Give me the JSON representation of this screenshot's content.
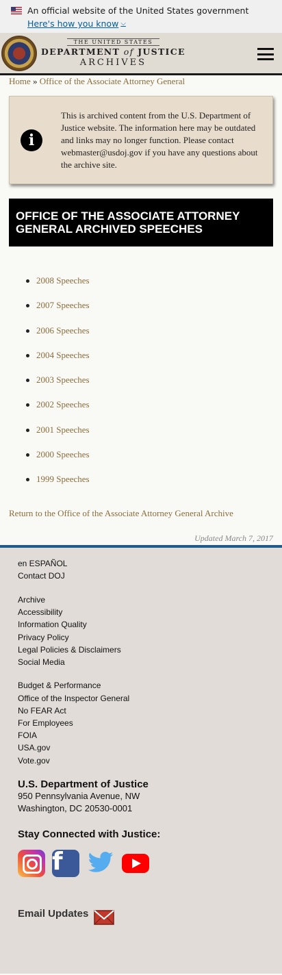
{
  "gov_banner": {
    "text": "An official website of the United States government",
    "link": "Here's how you know"
  },
  "header": {
    "logo_top": "THE UNITED STATES",
    "logo_mid_left": "DEPARTMENT",
    "logo_mid_of": "of",
    "logo_mid_right": "JUSTICE",
    "logo_bottom": "ARCHIVES"
  },
  "breadcrumb": {
    "home": "Home",
    "separator": "»",
    "current": "Office of the Associate Attorney General"
  },
  "notice": {
    "icon": "info-icon",
    "text": "This is archived content from the U.S. Department of Justice website. The information here may be outdated and links may no longer function. Please contact webmaster@usdoj.gov if you have any questions about the archive site."
  },
  "page_title": "OFFICE OF THE ASSOCIATE ATTORNEY GENERAL ARCHIVED SPEECHES",
  "speeches": [
    {
      "label": "2008 Speeches"
    },
    {
      "label": "2007 Speeches"
    },
    {
      "label": "2006 Speeches"
    },
    {
      "label": "2004 Speeches"
    },
    {
      "label": "2003 Speeches"
    },
    {
      "label": "2002 Speeches"
    },
    {
      "label": "2001 Speeches"
    },
    {
      "label": "2000 Speeches"
    },
    {
      "label": "1999 Speeches"
    }
  ],
  "return_link": "Return to the Office of the Associate Attorney General Archive",
  "updated": "Updated March 7, 2017",
  "footer": {
    "group1": [
      "en ESPAÑOL",
      "Contact DOJ"
    ],
    "group2": [
      "Archive",
      "Accessibility",
      "Information Quality",
      "Privacy Policy",
      "Legal Policies & Disclaimers",
      "Social Media"
    ],
    "group3": [
      "Budget & Performance",
      "Office of the Inspector General",
      "No FEAR Act",
      "For Employees",
      "FOIA",
      "USA.gov",
      "Vote.gov"
    ],
    "address_name": "U.S. Department of Justice",
    "address_line1": "950 Pennsylvania Avenue, NW",
    "address_line2": "Washington, DC 20530-0001",
    "stay_connected": "Stay Connected with Justice:",
    "social": [
      "instagram-icon",
      "facebook-icon",
      "twitter-icon",
      "youtube-icon"
    ],
    "email_updates": "Email Updates"
  },
  "colors": {
    "link": "#8a6d3b",
    "title_bg": "#000000",
    "notice_bg": "#e8dccd",
    "footer_border": "#1e5a8a",
    "footer_bg": "#e1dcd7"
  }
}
